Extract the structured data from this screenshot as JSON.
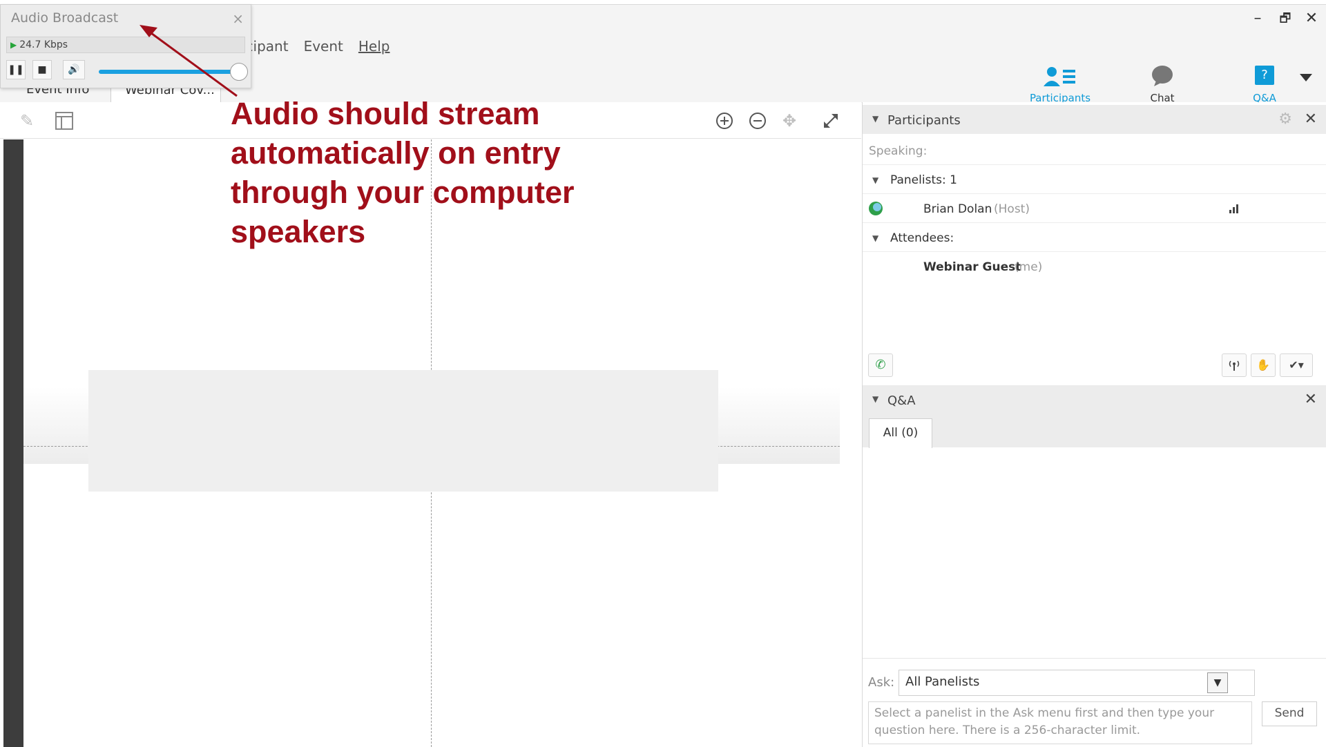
{
  "window": {
    "minimize_label": "–",
    "restore_label": "🗗",
    "close_label": "✕"
  },
  "menu": {
    "participant": "icipant",
    "event": "Event",
    "help": "Help"
  },
  "tabs": [
    {
      "label": "Event Info"
    },
    {
      "label": "Webinar Cov..."
    }
  ],
  "panel_tabs": {
    "participants": "Participants",
    "chat": "Chat",
    "qa": "Q&A",
    "qa_badge": "?"
  },
  "audio_broadcast": {
    "title": "Audio Broadcast",
    "close": "×",
    "bitrate": "24.7 Kbps",
    "volume_percent": 100
  },
  "annotation": {
    "lines": [
      "Audio should stream",
      "automatically on entry",
      "through your computer",
      "speakers"
    ]
  },
  "participants_panel": {
    "title": "Participants",
    "close": "✕",
    "speaking_label": "Speaking:",
    "panelists_label": "Panelists: 1",
    "panelist": {
      "name": "Brian Dolan",
      "role": "(Host)"
    },
    "attendees_label": "Attendees:",
    "attendee": {
      "name": "Webinar Guest",
      "role": "(me)"
    }
  },
  "qa_panel": {
    "title": "Q&A",
    "close": "✕",
    "tab_all": "All (0)",
    "ask_label": "Ask:",
    "ask_value": "All Panelists",
    "question_placeholder": "Select a panelist in the Ask menu first and then type your question here. There is a 256-character limit.",
    "send_label": "Send"
  },
  "colors": {
    "annotation": "#a10f1a",
    "accent_blue": "#0f9bd7",
    "slider": "#1aa0e0"
  },
  "icons": [
    "pencil-icon",
    "layout-icon",
    "zoom-in-icon",
    "zoom-out-icon",
    "move-icon",
    "fullscreen-icon",
    "participants-icon",
    "chat-icon",
    "qa-icon",
    "dropdown-icon",
    "gear-icon",
    "status-icon",
    "signal-icon",
    "phone-question-icon",
    "broadcast-icon",
    "raise-hand-icon",
    "feedback-icon",
    "play-icon",
    "pause-icon",
    "stop-icon",
    "volume-icon"
  ]
}
